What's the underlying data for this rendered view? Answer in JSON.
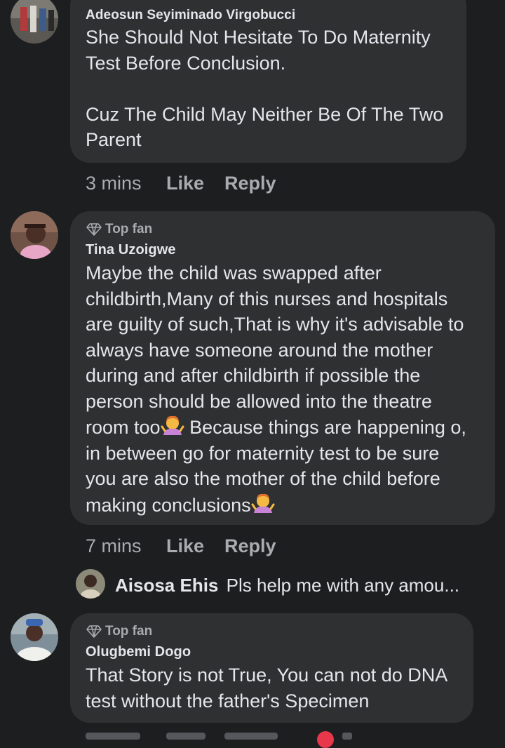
{
  "comments": [
    {
      "author": "Adeosun Seyiminado Virgobucci",
      "top_fan": false,
      "text": "She Should Not Hesitate To Do Maternity\nTest Before Conclusion.\n\nCuz The Child May Neither Be Of The Two\nParent",
      "time": "3 mins",
      "like_label": "Like",
      "reply_label": "Reply"
    },
    {
      "author": "Tina Uzoigwe",
      "top_fan": true,
      "top_fan_label": "Top fan",
      "text_part1": "Maybe the child was swapped after\nchildbirth,Many of this nurses and hospitals\nare guilty of such,That is why it's advisable to\nalways have someone around the mother\nduring and after childbirth if possible the\nperson should be allowed into the theatre\nroom too",
      "text_part2": " Because things are happening o,\nin between go for maternity test to be sure\nyou are also the mother of the child before\nmaking conclusions",
      "emoji": "woman-shrugging-emoji",
      "time": "7 mins",
      "like_label": "Like",
      "reply_label": "Reply",
      "reply_preview": {
        "author": "Aisosa Ehis",
        "text": "Pls help me with any amou..."
      }
    },
    {
      "author": "Olugbemi Dogo",
      "top_fan": true,
      "top_fan_label": "Top fan",
      "text": "That Story is not True, You can not do DNA\ntest without the father's Specimen"
    }
  ],
  "colors": {
    "background": "#1d1e20",
    "bubble": "#2f3032",
    "primary_text": "#e4e6eb",
    "secondary_text": "#a8abaf"
  }
}
